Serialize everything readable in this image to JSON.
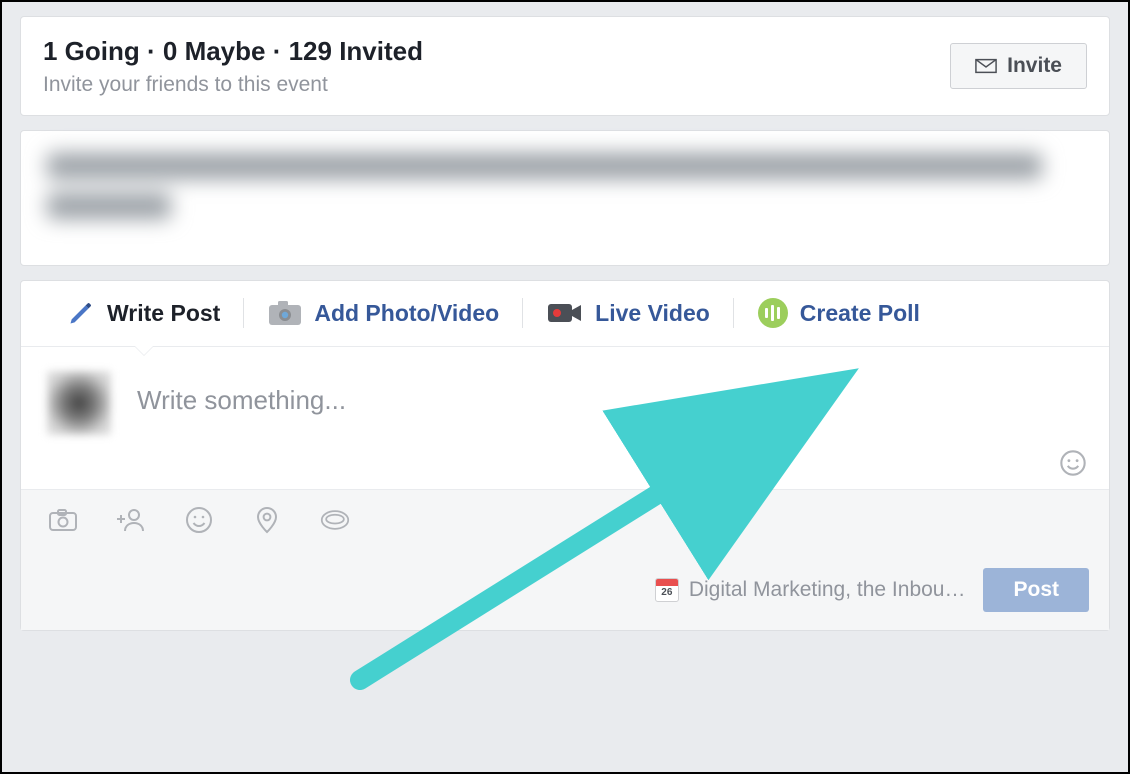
{
  "event": {
    "headline": "1 Going · 0 Maybe · 129 Invited",
    "subtext": "Invite your friends to this event",
    "invite_label": "Invite"
  },
  "composer": {
    "tabs": {
      "write": "Write Post",
      "photo": "Add Photo/Video",
      "live": "Live Video",
      "poll": "Create Poll"
    },
    "placeholder": "Write something...",
    "event_tag_label": "Digital Marketing, the Inbou…",
    "post_label": "Post"
  }
}
